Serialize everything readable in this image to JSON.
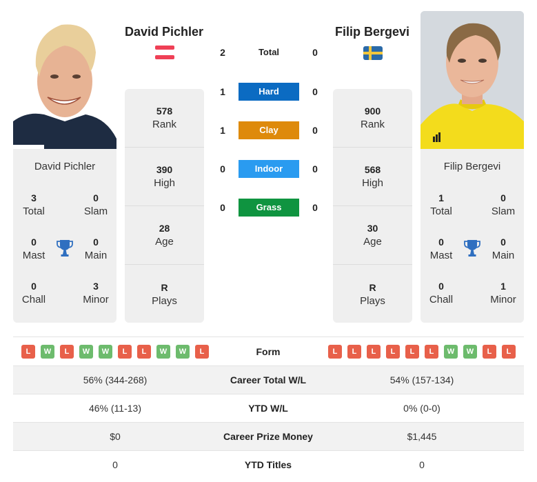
{
  "player_left": {
    "name": "David Pichler",
    "country_flag": "austria-flag",
    "photo_alt": "David Pichler photo",
    "stats": [
      {
        "value": "578",
        "label": "Rank"
      },
      {
        "value": "390",
        "label": "High"
      },
      {
        "value": "28",
        "label": "Age"
      },
      {
        "value": "R",
        "label": "Plays"
      }
    ],
    "titles": {
      "name": "David Pichler",
      "items": [
        {
          "value": "3",
          "label": "Total"
        },
        {
          "value": "0",
          "label": "Slam"
        },
        {
          "value": "0",
          "label": "Mast"
        },
        {
          "value": "0",
          "label": "Main"
        },
        {
          "value": "0",
          "label": "Chall"
        },
        {
          "value": "3",
          "label": "Minor"
        }
      ]
    },
    "form": [
      "L",
      "W",
      "L",
      "W",
      "W",
      "L",
      "L",
      "W",
      "W",
      "L"
    ]
  },
  "player_right": {
    "name": "Filip Bergevi",
    "country_flag": "sweden-flag",
    "photo_alt": "Filip Bergevi photo",
    "stats": [
      {
        "value": "900",
        "label": "Rank"
      },
      {
        "value": "568",
        "label": "High"
      },
      {
        "value": "30",
        "label": "Age"
      },
      {
        "value": "R",
        "label": "Plays"
      }
    ],
    "titles": {
      "name": "Filip Bergevi",
      "items": [
        {
          "value": "1",
          "label": "Total"
        },
        {
          "value": "0",
          "label": "Slam"
        },
        {
          "value": "0",
          "label": "Mast"
        },
        {
          "value": "0",
          "label": "Main"
        },
        {
          "value": "0",
          "label": "Chall"
        },
        {
          "value": "1",
          "label": "Minor"
        }
      ]
    },
    "form": [
      "L",
      "L",
      "L",
      "L",
      "L",
      "L",
      "W",
      "W",
      "L",
      "L"
    ]
  },
  "head_to_head": [
    {
      "label": "Total",
      "left": "2",
      "right": "0",
      "color": ""
    },
    {
      "label": "Hard",
      "left": "1",
      "right": "0",
      "color": "#0b6bc2"
    },
    {
      "label": "Clay",
      "left": "1",
      "right": "0",
      "color": "#de8a0b"
    },
    {
      "label": "Indoor",
      "left": "0",
      "right": "0",
      "color": "#2a9bf0"
    },
    {
      "label": "Grass",
      "left": "0",
      "right": "0",
      "color": "#0f9440"
    }
  ],
  "form_label": "Form",
  "comparison": [
    {
      "label": "Career Total W/L",
      "left": "56% (344-268)",
      "right": "54% (157-134)"
    },
    {
      "label": "YTD W/L",
      "left": "46% (11-13)",
      "right": "0% (0-0)"
    },
    {
      "label": "Career Prize Money",
      "left": "$0",
      "right": "$1,445"
    },
    {
      "label": "YTD Titles",
      "left": "0",
      "right": "0"
    }
  ],
  "colors": {
    "loss": "#e8604a",
    "win": "#6dbb6d",
    "trophy": "#2f6fc0",
    "card_bg": "#efefef"
  }
}
